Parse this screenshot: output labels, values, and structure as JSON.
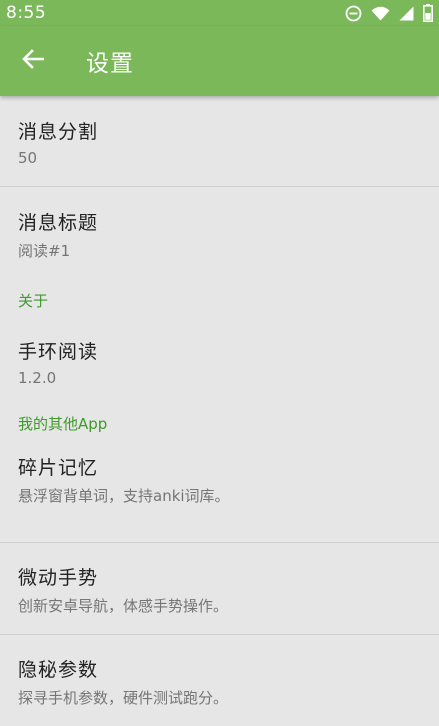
{
  "status_bar": {
    "time": "8:55",
    "icons": [
      "do-not-disturb-icon",
      "wifi-icon",
      "signal-icon",
      "battery-icon"
    ]
  },
  "app_bar": {
    "title": "设置",
    "back_icon": "arrow-back-icon",
    "color": "#7ab85a"
  },
  "preferences": {
    "split": {
      "title": "消息分割",
      "summary": "50"
    },
    "msg_title": {
      "title": "消息标题",
      "summary": "阅读#1"
    },
    "about_header": "关于",
    "app_info": {
      "title": "手环阅读",
      "summary": "1.2.0"
    },
    "other_apps_header": "我的其他App",
    "apps": [
      {
        "title": "碎片记忆",
        "summary": "悬浮窗背单词，支持anki词库。"
      },
      {
        "title": "微动手势",
        "summary": "创新安卓导航，体感手势操作。"
      },
      {
        "title": "隐秘参数",
        "summary": "探寻手机参数，硬件测试跑分。"
      }
    ]
  },
  "colors": {
    "accent": "#3d9b2a",
    "background": "#e6e6e6"
  }
}
